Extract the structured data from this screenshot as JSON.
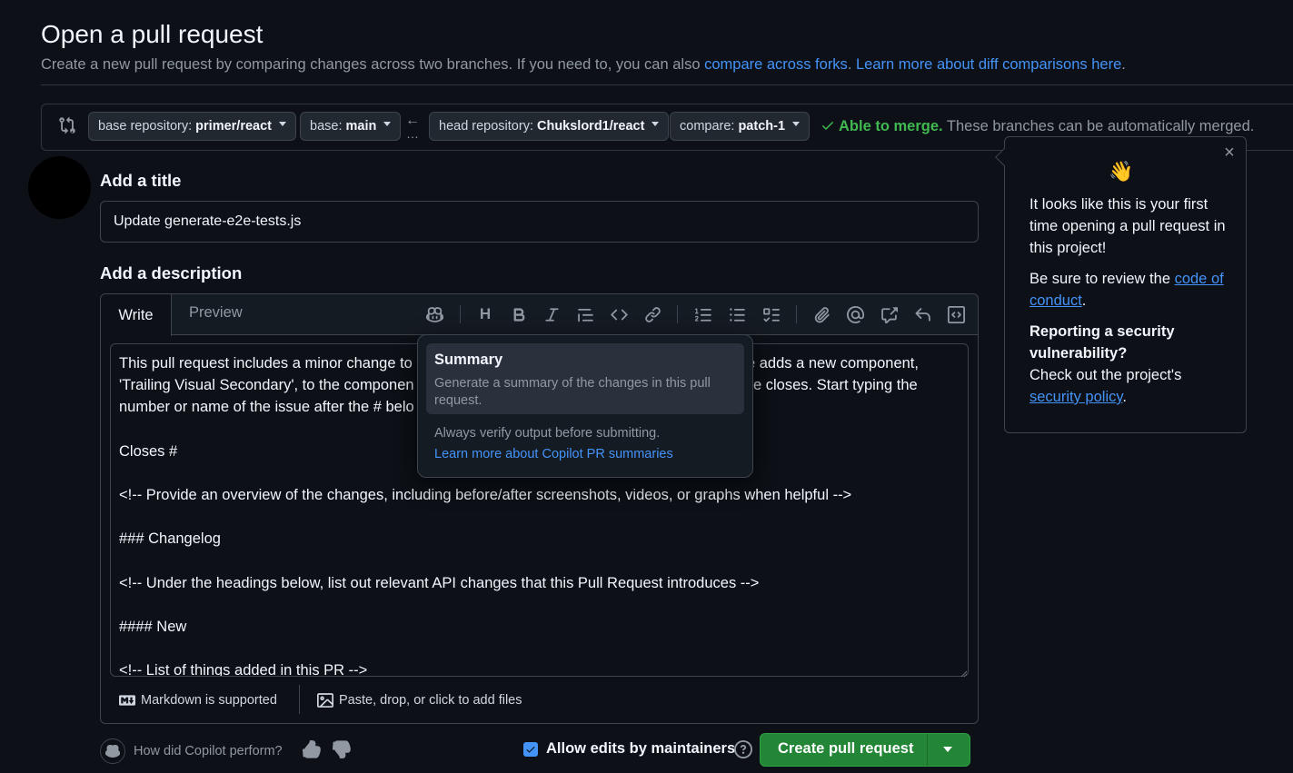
{
  "header": {
    "title": "Open a pull request",
    "subtitle_prefix": "Create a new pull request by comparing changes across two branches. If you need to, you can also ",
    "link_forks": "compare across forks",
    "subtitle_mid": ". ",
    "link_learn": "Learn more about diff comparisons here",
    "subtitle_end": "."
  },
  "compare": {
    "base_repo_label": "base repository:",
    "base_repo_value": "primer/react",
    "base_label": "base:",
    "base_value": "main",
    "arrow": "←",
    "dots": "…",
    "head_repo_label": "head repository:",
    "head_repo_value": "Chukslord1/react",
    "compare_label": "compare:",
    "compare_value": "patch-1",
    "merge_ok": "Able to merge.",
    "merge_text": " These branches can be automatically merged."
  },
  "form": {
    "title_label": "Add a title",
    "title_value": "Update generate-e2e-tests.js",
    "desc_label": "Add a description"
  },
  "editor": {
    "tab_write": "Write",
    "tab_preview": "Preview",
    "lines": [
      "This pull request includes a minor change to",
      "'Trailing Visual Secondary', to the componen",
      "number or name of the issue after the # belo",
      "Closes #",
      "<!-- Provide an overview of the changes, including before/after screenshots, videos, or graphs when helpful -->",
      "### Changelog",
      "<!-- Under the headings below, list out relevant API changes that this Pull Request introduces -->",
      "#### New",
      "<!-- List of things added in this PR -->"
    ],
    "line1_right": "e adds a new component,",
    "line2_right": "e closes. Start typing the",
    "markdown_note": "Markdown is supported",
    "attach_note": "Paste, drop, or click to add files"
  },
  "copilot_menu": {
    "title": "Summary",
    "description": "Generate a summary of the changes in this pull request.",
    "note": "Always verify output before submitting.",
    "link": "Learn more about Copilot PR summaries"
  },
  "first_time_tip": {
    "emoji": "👋",
    "intro": "It looks like this is your first time opening a pull request in this project!",
    "review_prefix": "Be sure to review the ",
    "review_link": "code of conduct",
    "review_suffix": ".",
    "security_heading": "Reporting a security vulnerability?",
    "security_prefix": "Check out the project's ",
    "security_link": "security policy",
    "security_suffix": ".",
    "close": "×"
  },
  "footer": {
    "copilot_question": "How did Copilot perform?",
    "allow_edits": "Allow edits by maintainers",
    "allow_edits_checked": true,
    "create_button": "Create pull request"
  },
  "colors": {
    "background": "#0d1117",
    "accent_link": "#4493f8",
    "success": "#3fb950",
    "primary_button": "#238636"
  }
}
